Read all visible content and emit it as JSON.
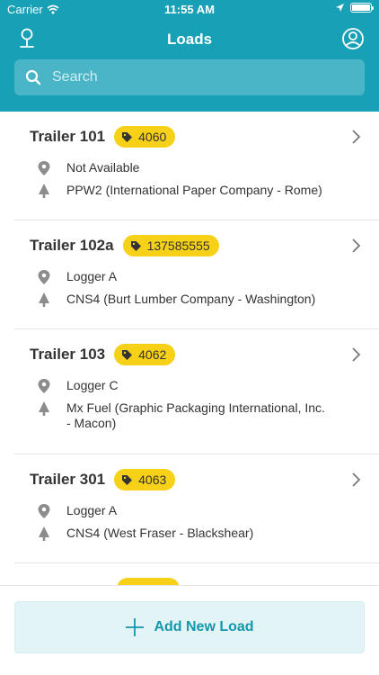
{
  "status_bar": {
    "carrier": "Carrier",
    "time": "11:55 AM"
  },
  "nav": {
    "title": "Loads"
  },
  "search": {
    "placeholder": "Search"
  },
  "loads": [
    {
      "title": "Trailer 101",
      "tag": "4060",
      "location": "Not Available",
      "destination": "PPW2 (International Paper Company - Rome)"
    },
    {
      "title": "Trailer 102a",
      "tag": "137585555",
      "location": "Logger A",
      "destination": "CNS4 (Burt Lumber Company - Washington)"
    },
    {
      "title": "Trailer 103",
      "tag": "4062",
      "location": "Logger C",
      "destination": "Mx Fuel (Graphic Packaging International, Inc. - Macon)"
    },
    {
      "title": "Trailer 301",
      "tag": "4063",
      "location": "Logger A",
      "destination": "CNS4 (West Fraser - Blackshear)"
    }
  ],
  "footer": {
    "add_label": "Add New Load"
  },
  "colors": {
    "accent": "#18a0b6",
    "tag": "#f7d117",
    "button_bg": "#e3f4f7",
    "button_text": "#1397ad"
  }
}
